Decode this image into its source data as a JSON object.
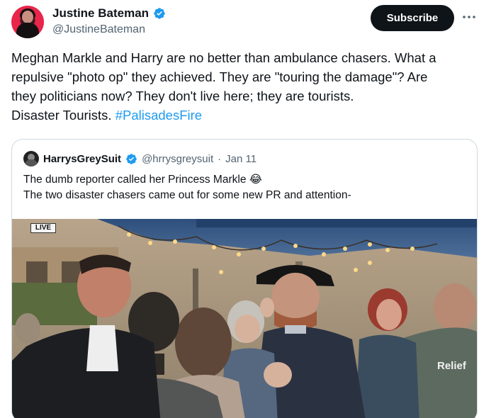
{
  "author": {
    "name": "Justine Bateman",
    "handle": "@JustineBateman",
    "verified_color": "#1d9bf0"
  },
  "actions": {
    "subscribe_label": "Subscribe",
    "more_icon": "more-horizontal-icon"
  },
  "tweet": {
    "text_lines": [
      "Meghan Markle and Harry are no better than ambulance chasers. What a",
      "repulsive \"photo op\" they achieved. They are \"touring the damage\"? Are",
      "they politicians now? They don't live here; they are tourists.",
      "Disaster Tourists."
    ],
    "hashtag": "#PalisadesFire"
  },
  "quoted": {
    "name": "HarrysGreySuit",
    "handle": "@hrrysgreysuit",
    "separator": "·",
    "date": "Jan 11",
    "text_lines": [
      "The dumb reporter called her Princess Markle 😂",
      "The two disaster chasers came out for some new PR and attention-"
    ],
    "media": {
      "live_badge": "LIVE",
      "vest_text": "Relief"
    }
  },
  "colors": {
    "text": "#0f1419",
    "muted": "#536471",
    "link": "#1d9bf0",
    "border": "#cfd9de"
  }
}
